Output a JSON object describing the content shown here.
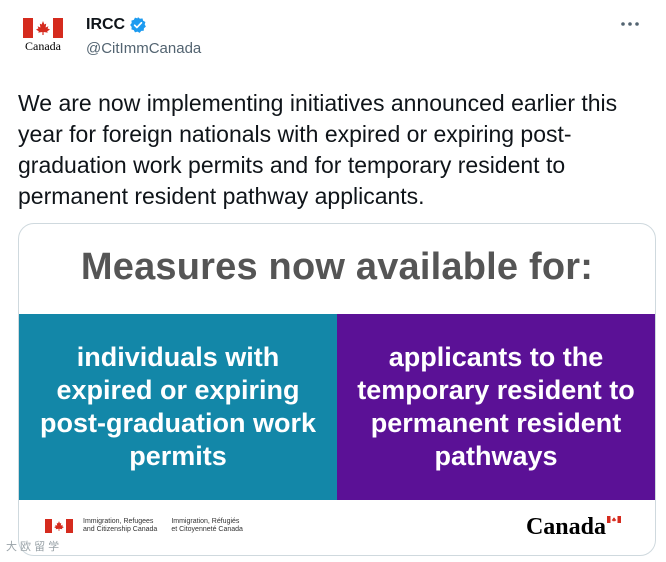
{
  "account": {
    "display_name": "IRCC",
    "handle": "@CitImmCanada",
    "avatar_word": "Canada",
    "verified": true
  },
  "tweet": {
    "text": "We are now implementing initiatives announced earlier this year for foreign nationals with expired or expiring post-graduation work permits and for temporary resident to permanent resident pathway applicants."
  },
  "media": {
    "headline": "Measures now available for:",
    "left_panel": "individuals with expired or expiring post-graduation work permits",
    "right_panel": "applicants to the temporary resident to permanent resident pathways",
    "dept_en": "Immigration, Refugees\nand Citizenship Canada",
    "dept_fr": "Immigration, Réfugiés\net Citoyenneté Canada",
    "wordmark": "Canada",
    "colors": {
      "left_panel": "#1387a8",
      "right_panel": "#5b1196",
      "headline": "#555555",
      "flag_red": "#d52b1e"
    }
  },
  "icons": [
    "canada-flag-icon",
    "verified-badge-icon",
    "more-options-icon"
  ],
  "watermark": "大 欧 留 学"
}
